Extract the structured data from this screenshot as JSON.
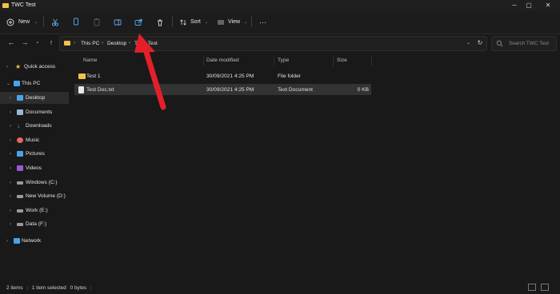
{
  "window": {
    "title": "TWC Test"
  },
  "commandbar": {
    "new_label": "New",
    "sort_label": "Sort",
    "view_label": "View",
    "more_label": "···"
  },
  "address": {
    "crumbs": [
      "This PC",
      "Desktop",
      "TWC Test"
    ],
    "search_placeholder": "Search TWC Test"
  },
  "sidebar": {
    "items": [
      {
        "label": "Quick access",
        "icon": "star-icon",
        "color": "#f2c14e"
      },
      {
        "label": "This PC",
        "icon": "computer-icon",
        "color": "#4aa3e8"
      },
      {
        "label": "Desktop",
        "icon": "desktop-icon",
        "color": "#4aa3e8"
      },
      {
        "label": "Documents",
        "icon": "documents-icon",
        "color": "#9bb7d4"
      },
      {
        "label": "Downloads",
        "icon": "downloads-icon",
        "color": "#3fb7a8"
      },
      {
        "label": "Music",
        "icon": "music-icon",
        "color": "#e86a5a"
      },
      {
        "label": "Pictures",
        "icon": "pictures-icon",
        "color": "#4aa3e8"
      },
      {
        "label": "Videos",
        "icon": "videos-icon",
        "color": "#9b59d6"
      },
      {
        "label": "Windows (C:)",
        "icon": "drive-icon",
        "color": "#9a9a9a"
      },
      {
        "label": "New Volume (D:)",
        "icon": "drive-icon",
        "color": "#9a9a9a"
      },
      {
        "label": "Work (E:)",
        "icon": "drive-icon",
        "color": "#9a9a9a"
      },
      {
        "label": "Data (F:)",
        "icon": "drive-icon",
        "color": "#9a9a9a"
      },
      {
        "label": "Network",
        "icon": "network-icon",
        "color": "#4aa3e8"
      }
    ]
  },
  "content": {
    "columns": [
      "Name",
      "Date modified",
      "Type",
      "Size"
    ],
    "rows": [
      {
        "name": "Test 1",
        "date": "30/09/2021 4:25 PM",
        "type": "File folder",
        "size": ""
      },
      {
        "name": "Test Doc.txt",
        "date": "30/09/2021 4:25 PM",
        "type": "Text Document",
        "size": "0 KB"
      }
    ]
  },
  "status": {
    "items": "2 items",
    "selected": "1 item selected",
    "bytes": "0 bytes"
  },
  "colors": {
    "accent_arrow": "#e3202a",
    "folder": "#f2c14e"
  }
}
